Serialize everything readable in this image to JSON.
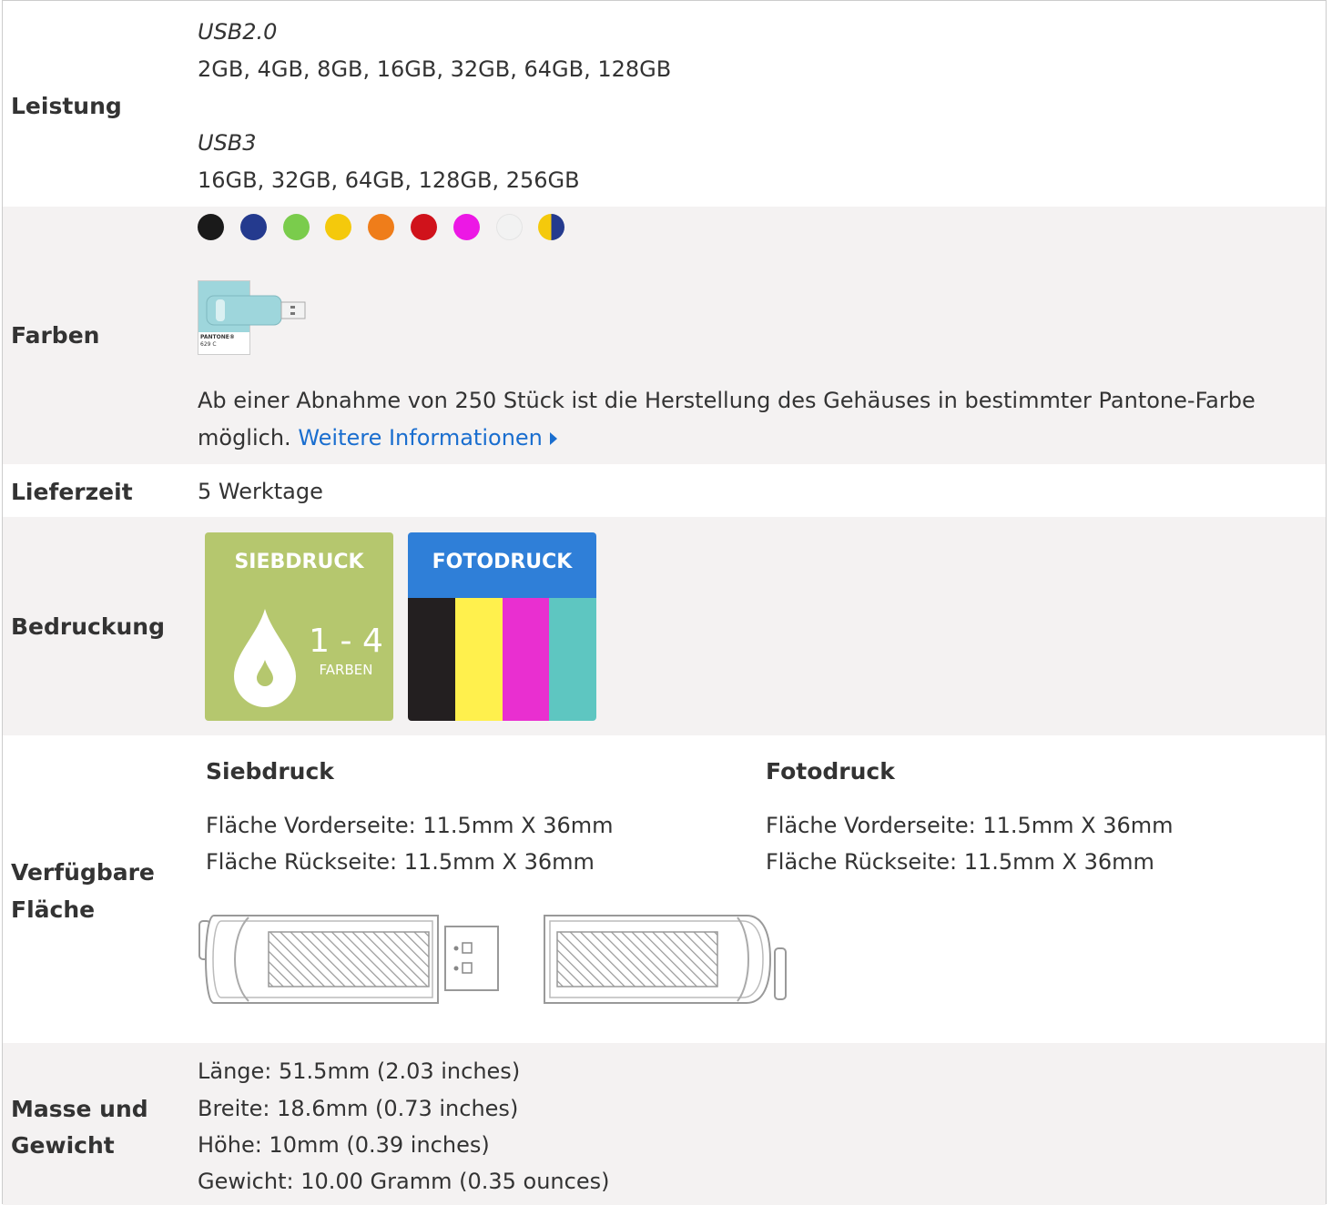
{
  "leistung": {
    "label": "Leistung",
    "usb2_title": "USB2.0",
    "usb2_values": "2GB, 4GB, 8GB, 16GB, 32GB, 64GB, 128GB",
    "usb3_title": "USB3",
    "usb3_values": "16GB, 32GB, 64GB, 128GB, 256GB"
  },
  "farben": {
    "label": "Farben",
    "colors": [
      "#1a1a1a",
      "#243a8e",
      "#7acc4c",
      "#f4c90c",
      "#ef7d1a",
      "#d0121b",
      "#ec18e5",
      "#f2f2f2",
      "#f4c90c/#243a8e"
    ],
    "pantone_brand": "PANTONE®",
    "pantone_code": "629 C",
    "description": "Ab einer Abnahme von 250 Stück ist die Herstellung des Gehäuses in bestimmter Pantone-Farbe",
    "description_end": "möglich.",
    "more_link": "Weitere Informationen"
  },
  "lieferzeit": {
    "label": "Lieferzeit",
    "value": "5 Werktage"
  },
  "bedruckung": {
    "label": "Bedruckung",
    "siebdruck_title": "SIEBDRUCK",
    "siebdruck_range": "1 - 4",
    "siebdruck_unit": "FARBEN",
    "fotodruck_title": "FOTODRUCK",
    "siebdruck_color": "#b5c76e",
    "fotodruck_color": "#2f7fd8",
    "cmyk": [
      "#231f20",
      "#fff04d",
      "#e92fd0",
      "#5ec6c1"
    ]
  },
  "flaeche": {
    "label_line1": "Verfügbare",
    "label_line2": "Fläche",
    "sieb_title": "Siebdruck",
    "sieb_front": "Fläche Vorderseite: 11.5mm X 36mm",
    "sieb_back": "Fläche Rückseite: 11.5mm X 36mm",
    "foto_title": "Fotodruck",
    "foto_front": "Fläche Vorderseite: 11.5mm X 36mm",
    "foto_back": "Fläche Rückseite: 11.5mm X 36mm"
  },
  "masse": {
    "label_line1": "Masse und",
    "label_line2": "Gewicht",
    "laenge": "Länge: 51.5mm (2.03 inches)",
    "breite": "Breite: 18.6mm (0.73 inches)",
    "hoehe": "Höhe: 10mm (0.39 inches)",
    "gewicht": "Gewicht: 10.00 Gramm (0.35 ounces)"
  }
}
